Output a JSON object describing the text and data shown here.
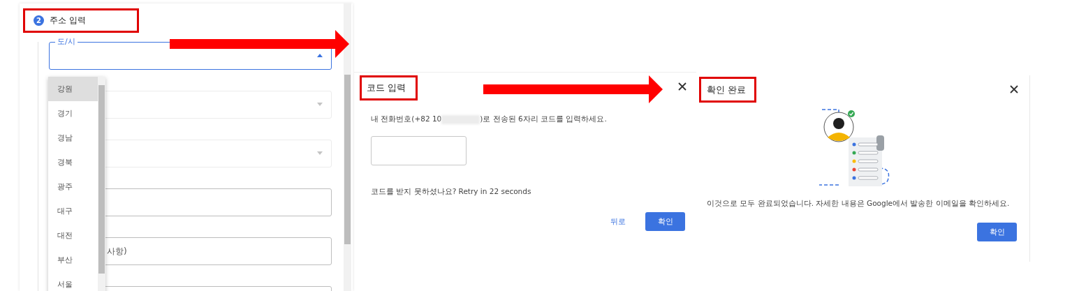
{
  "address_form": {
    "step": "2",
    "title": "주소 입력",
    "title_highlighted": true,
    "arrow_out": true,
    "city_select": {
      "label": "도/시",
      "expanded": true
    },
    "city_options": [
      {
        "label": "강원",
        "selected": true
      },
      {
        "label": "경기",
        "selected": false
      },
      {
        "label": "경남",
        "selected": false
      },
      {
        "label": "경북",
        "selected": false
      },
      {
        "label": "광주",
        "selected": false
      },
      {
        "label": "대구",
        "selected": false
      },
      {
        "label": "대전",
        "selected": false
      },
      {
        "label": "부산",
        "selected": false
      },
      {
        "label": "서울",
        "selected": false
      }
    ],
    "fields": [
      {
        "kind": "select"
      },
      {
        "kind": "select"
      },
      {
        "kind": "text"
      },
      {
        "kind": "text",
        "placeholder": "사항)"
      },
      {
        "kind": "text"
      }
    ]
  },
  "code_dialog": {
    "title": "코드 입력",
    "title_highlighted": true,
    "arrow_out": true,
    "message_before": "내 전화번호(+82 10",
    "phone_redacted": true,
    "message_after": ")로 전송된 6자리 코드를 입력하세요.",
    "retry_text": "코드를 받지 못하셨나요? Retry in 22 seconds",
    "back_button": "뒤로",
    "confirm_button": "확인"
  },
  "done_dialog": {
    "title": "확인 완료",
    "title_highlighted": true,
    "message": "이것으로 모두 완료되었습니다. 자세한 내용은 Google에서 발송한 이메일을 확인하세요.",
    "confirm_button": "확인"
  }
}
